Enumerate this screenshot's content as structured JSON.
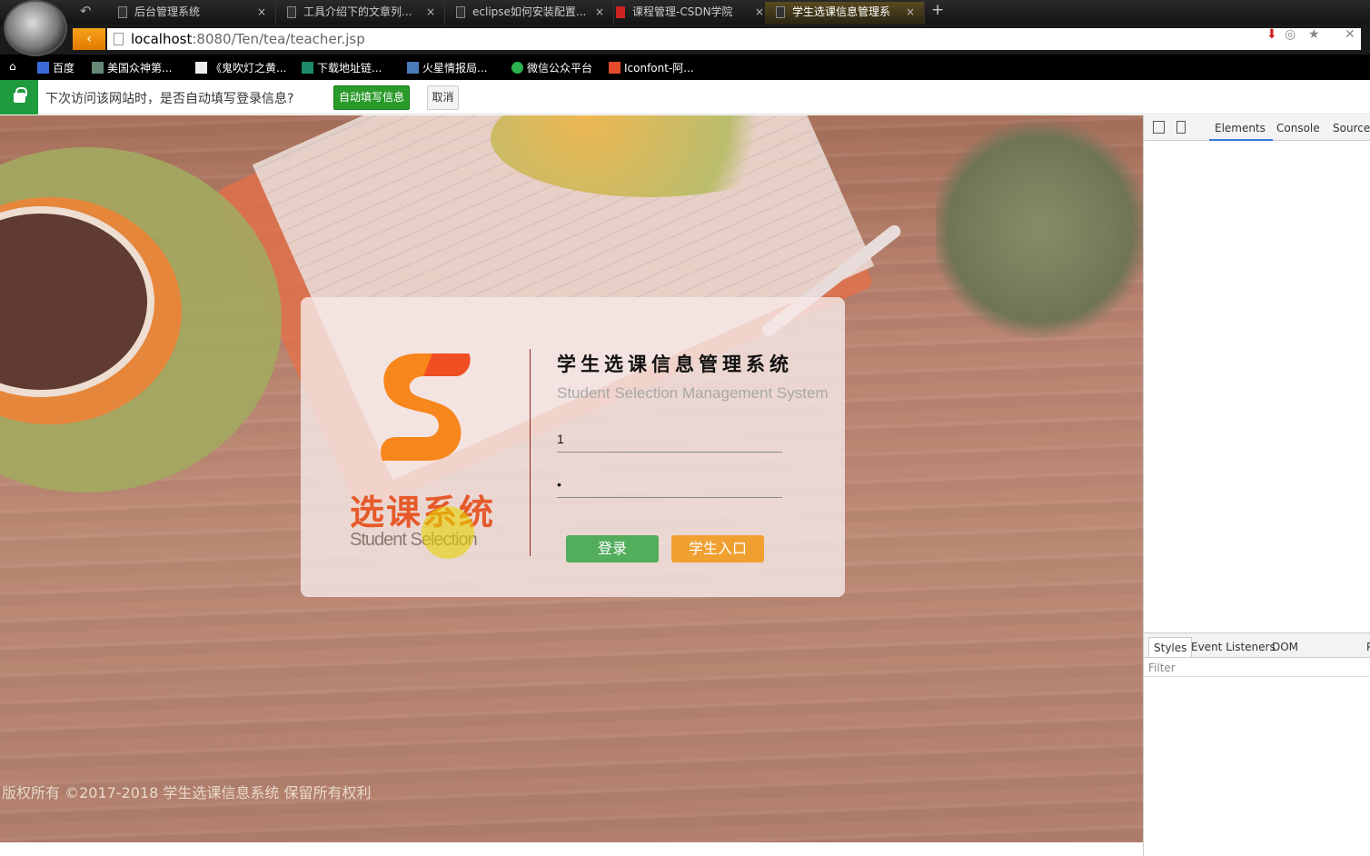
{
  "browser": {
    "tabs": [
      {
        "label": "后台管理系统",
        "active": false
      },
      {
        "label": "工具介绍下的文章列...",
        "active": false
      },
      {
        "label": "eclipse如何安装配置...",
        "active": false
      },
      {
        "label": "课程管理-CSDN学院",
        "active": false
      },
      {
        "label": "学生选课信息管理系",
        "active": true
      }
    ],
    "tab_close": "×",
    "new_tab": "+",
    "url_host": "localhost",
    "url_path": ":8080/Ten/tea/teacher.jsp",
    "bookmarks": [
      "百度",
      "美国众神第...",
      "《鬼吹灯之黄...",
      "下载地址链...",
      "火星情报局...",
      "微信公众平台",
      "Iconfont-阿..."
    ]
  },
  "password_bar": {
    "message": "下次访问该网站时，是否自动填写登录信息?",
    "autofill_label": "自动填写信息",
    "cancel_label": "取消"
  },
  "login": {
    "logo_cn": "选课系统",
    "logo_en": "Student Selection",
    "title": "学生选课信息管理系统",
    "subtitle": "Student Selection Management System",
    "username_value": "1",
    "password_value": "1",
    "login_label": "登录",
    "student_label": "学生入口"
  },
  "footer": {
    "text": "版权所有 ©2017-2018 学生选课信息系统 保留所有权利"
  },
  "devtools": {
    "tabs": [
      "Elements",
      "Console",
      "Sources"
    ],
    "active_tab": "Elements",
    "sub_tabs": [
      "Styles",
      "Event Listeners",
      "DOM Breakpoints",
      "P"
    ],
    "filter_placeholder": "Filter"
  },
  "colors": {
    "accent": "#f0a030",
    "login_green": "#52ad5c",
    "logo_red": "#e65a2a",
    "autofill_green": "#2a9a2a"
  }
}
